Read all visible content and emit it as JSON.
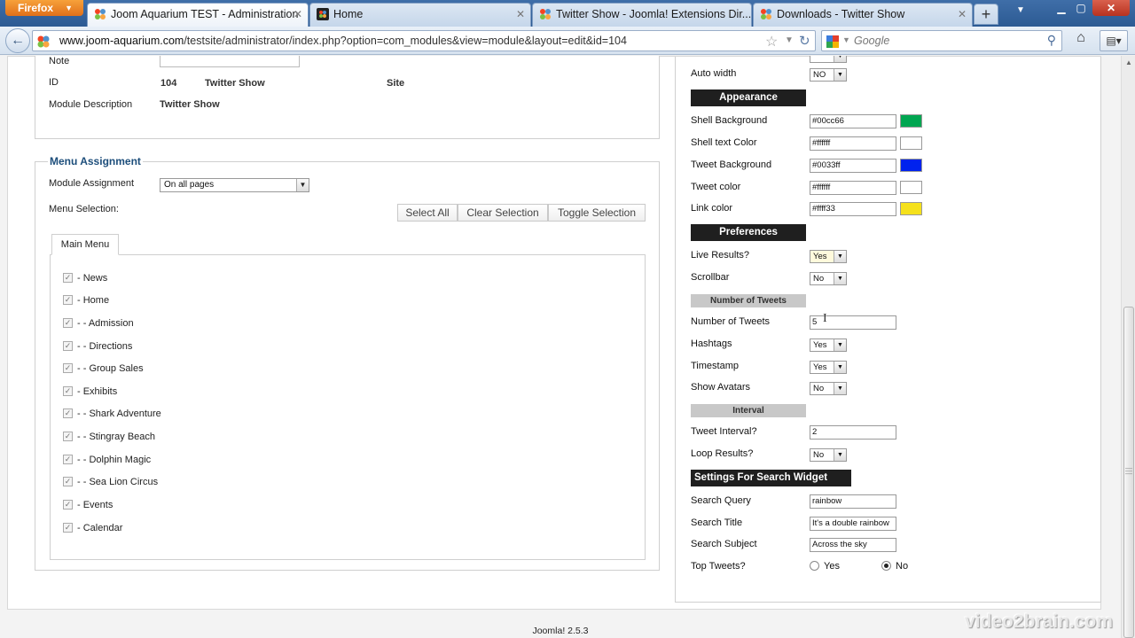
{
  "browser": {
    "app_button": "Firefox",
    "tabs": [
      {
        "title": "Joom Aquarium TEST - Administration",
        "active": true
      },
      {
        "title": "Home",
        "active": false
      },
      {
        "title": "Twitter Show - Joomla! Extensions Dir...",
        "active": false
      },
      {
        "title": "Downloads - Twitter Show",
        "active": false
      }
    ],
    "new_tab_glyph": "+",
    "url_domain": "www.joom-aquarium.com",
    "url_path": "/testsite/administrator/index.php?option=com_modules&view=module&layout=edit&id=104",
    "search_placeholder": "Google"
  },
  "details": {
    "note_label": "Note",
    "id_label": "ID",
    "id_value": "104",
    "module_name": "Twitter Show",
    "client": "Site",
    "desc_label": "Module Description",
    "desc_value": "Twitter Show"
  },
  "menu_assignment": {
    "legend": "Menu Assignment",
    "module_assignment_label": "Module Assignment",
    "module_assignment_value": "On all pages",
    "menu_selection_label": "Menu Selection:",
    "buttons": {
      "select_all": "Select All",
      "clear_selection": "Clear Selection",
      "toggle_selection": "Toggle Selection"
    },
    "tab_label": "Main Menu",
    "items": [
      "- News",
      "- Home",
      "- - Admission",
      "- - Directions",
      "- - Group Sales",
      "- Exhibits",
      "- - Shark Adventure",
      "- - Stingray Beach",
      "- - Dolphin Magic",
      "- - Sea Lion Circus",
      "- Events",
      "- Calendar"
    ]
  },
  "options": {
    "auto_width_label": "Auto width",
    "auto_width_value": "NO",
    "appearance_header": "Appearance",
    "shell_bg_label": "Shell Background",
    "shell_bg_value": "#00cc66",
    "shell_text_label": "Shell text Color",
    "shell_text_value": "#ffffff",
    "tweet_bg_label": "Tweet Background",
    "tweet_bg_value": "#0033ff",
    "tweet_color_label": "Tweet color",
    "tweet_color_value": "#ffffff",
    "link_color_label": "Link color",
    "link_color_value": "#ffff33",
    "swatch_colors": {
      "shell_bg": "#00a651",
      "shell_text": "#ffffff",
      "tweet_bg": "#0022ee",
      "tweet_color": "#ffffff",
      "link_color": "#f5e11c"
    },
    "preferences_header": "Preferences",
    "live_results_label": "Live Results?",
    "live_results_value": "Yes",
    "scrollbar_label": "Scrollbar",
    "scrollbar_value": "No",
    "num_tweets_header": "Number of Tweets",
    "num_tweets_label": "Number of Tweets",
    "num_tweets_value": "5",
    "hashtags_label": "Hashtags",
    "hashtags_value": "Yes",
    "timestamp_label": "Timestamp",
    "timestamp_value": "Yes",
    "avatars_label": "Show Avatars",
    "avatars_value": "No",
    "interval_header": "Interval",
    "tweet_interval_label": "Tweet Interval?",
    "tweet_interval_value": "2",
    "loop_label": "Loop Results?",
    "loop_value": "No",
    "search_header": "Settings For Search Widget Only",
    "search_query_label": "Search Query",
    "search_query_value": "rainbow",
    "search_title_label": "Search Title",
    "search_title_value": "It's a double rainbow",
    "search_subject_label": "Search Subject",
    "search_subject_value": "Across the sky",
    "top_tweets_label": "Top Tweets?",
    "top_yes": "Yes",
    "top_no": "No",
    "top_selected": "No"
  },
  "footer": "Joomla! 2.5.3",
  "watermark": "video2brain.com"
}
